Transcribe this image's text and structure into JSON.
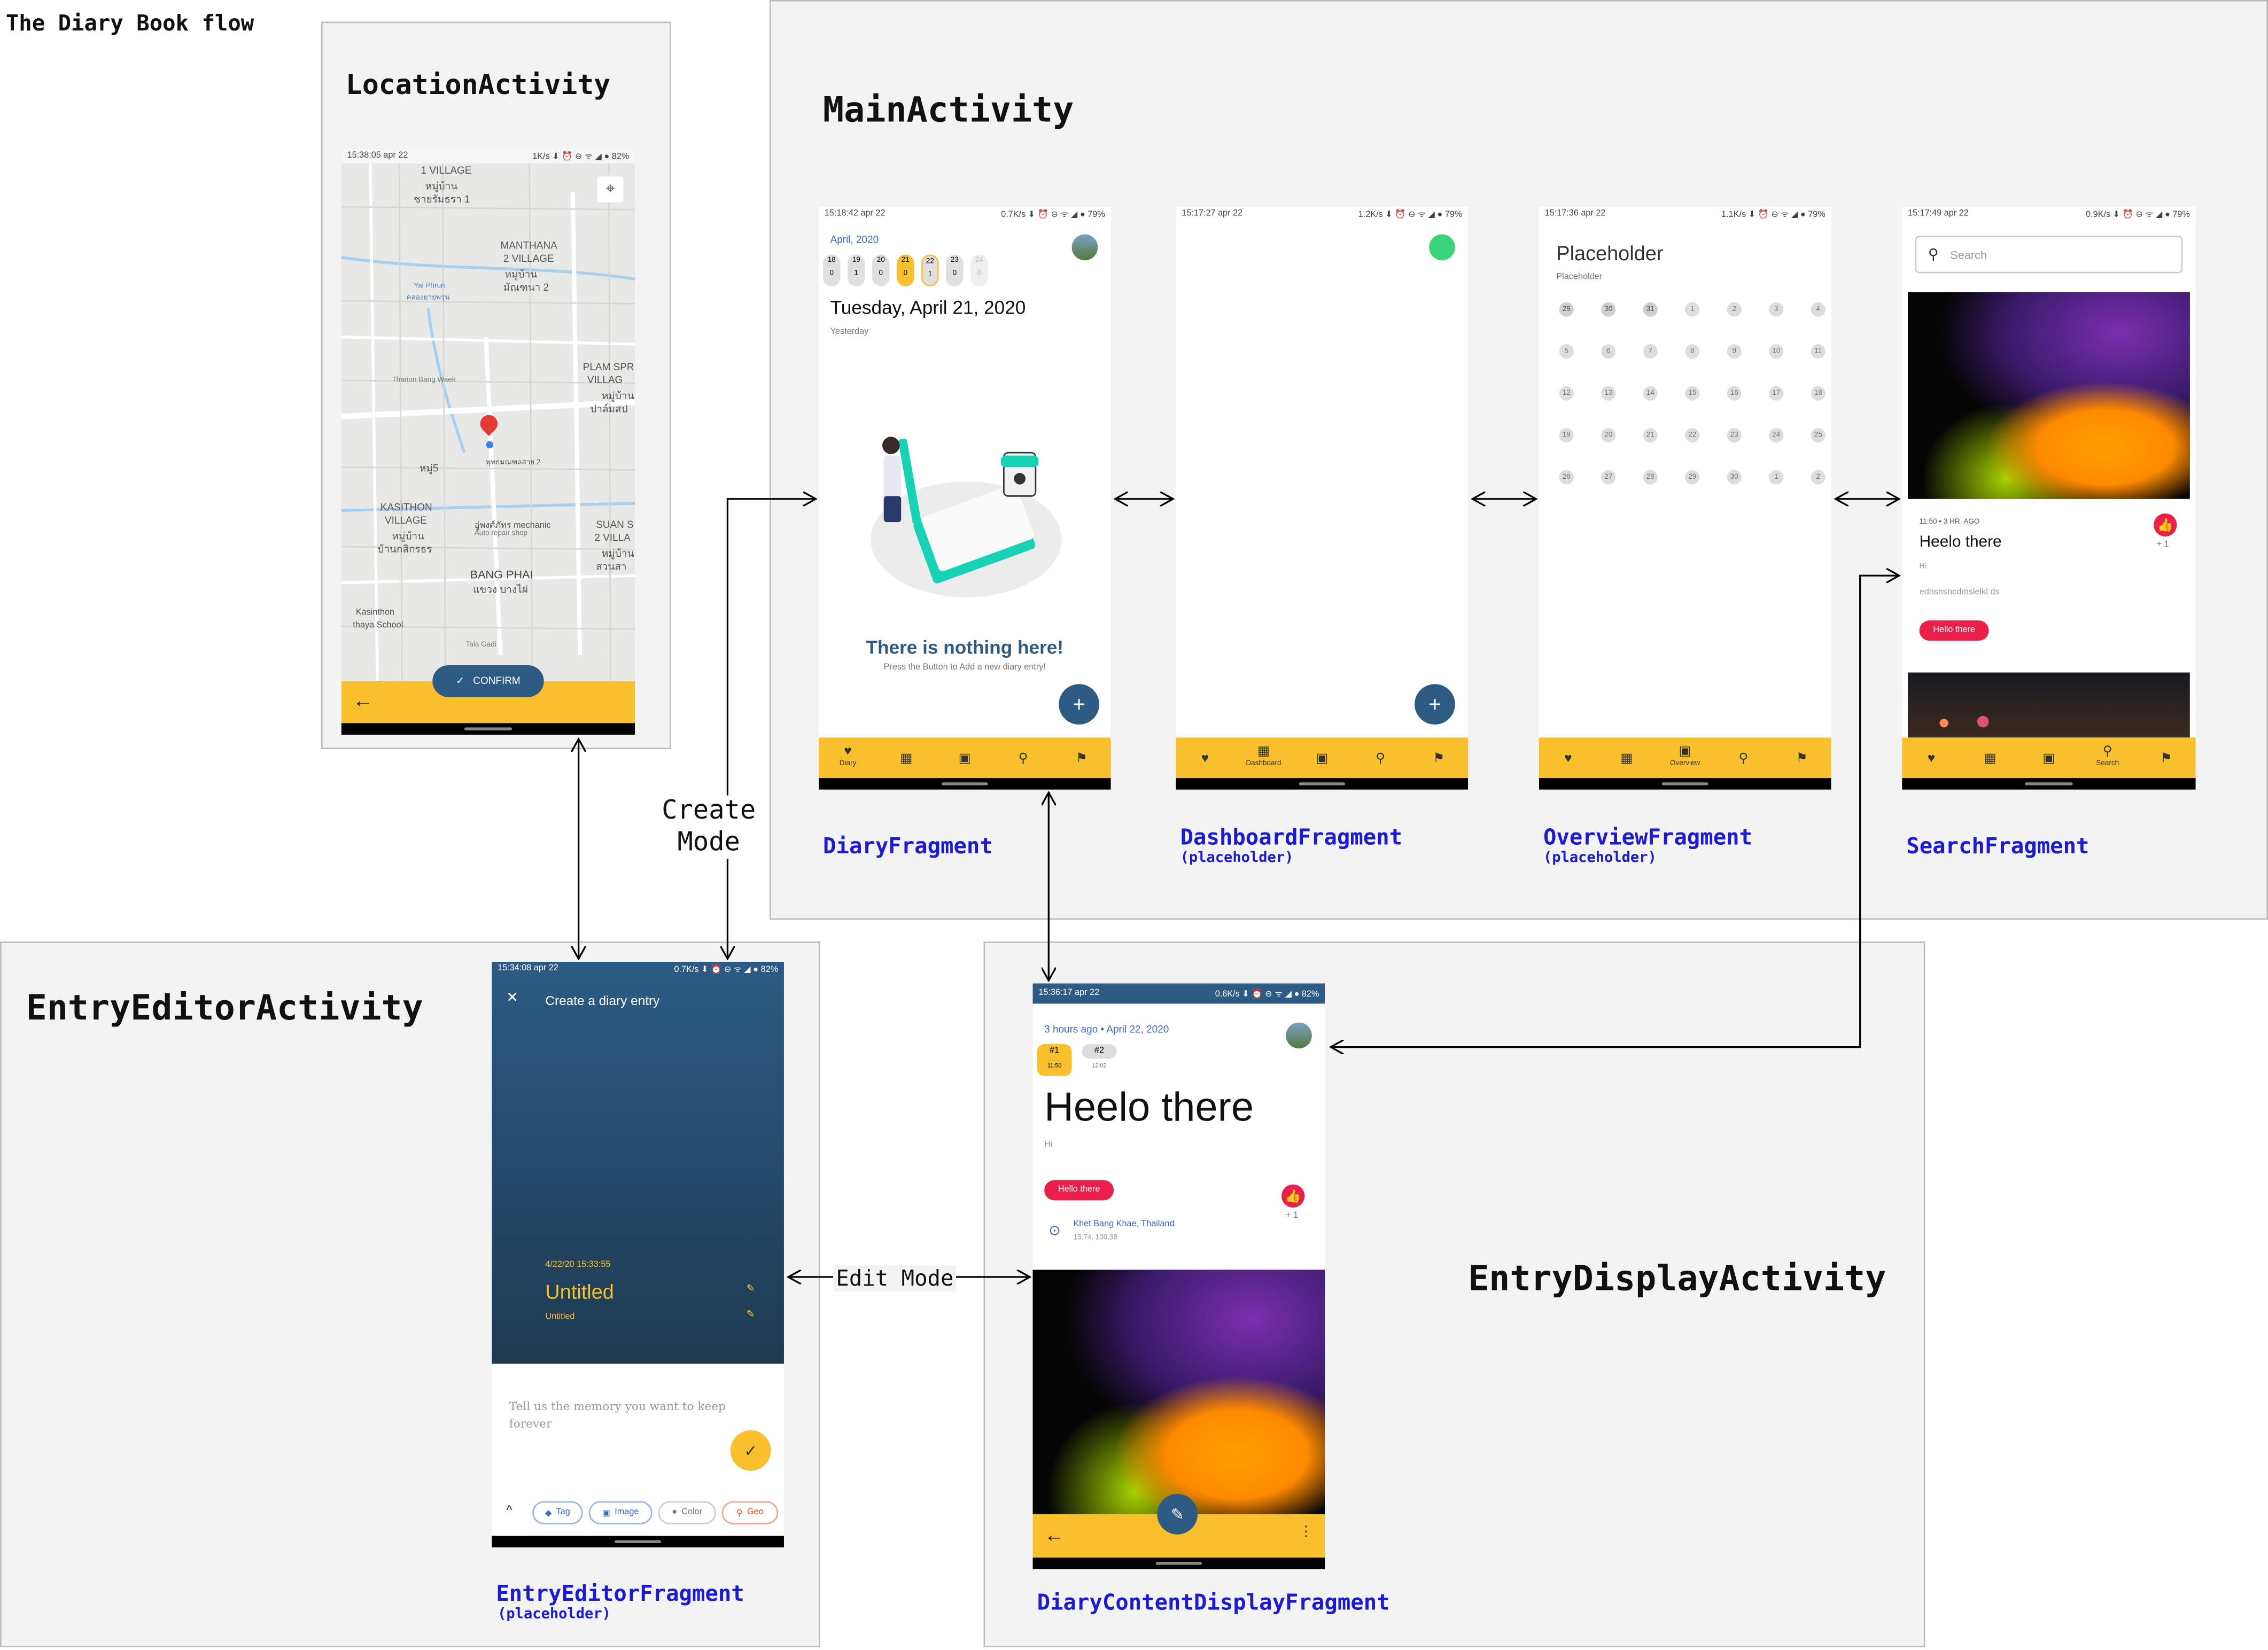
{
  "diagram_title": "The Diary Book flow",
  "sections": {
    "location": "LocationActivity",
    "main": "MainActivity",
    "editor": "EntryEditorActivity",
    "display": "EntryDisplayActivity"
  },
  "fragments": {
    "diary": "DiaryFragment",
    "dashboard": "DashboardFragment",
    "overview": "OverviewFragment",
    "search": "SearchFragment",
    "editor": "EntryEditorFragment",
    "content": "DiaryContentDisplayFragment",
    "placeholder_note": "(placeholder)"
  },
  "flow_labels": {
    "create_line1": "Create",
    "create_line2": "Mode",
    "edit": "Edit Mode"
  },
  "location_screen": {
    "status_time": "15:38:05 apr 22",
    "status_right": "1K/s ⬇ ⏰ ⊖ ᯤ ◢ ● 82%",
    "map_labels": [
      "1 VILLAGE",
      "หมู่บ้าน",
      "ชายรัมธรา 1",
      "MANTHANA",
      "2 VILLAGE",
      "หมู่บ้าน",
      "มัณฑนา 2",
      "Yai Phrun",
      "คลองยายพรุน",
      "Thanon Bang Waek",
      "PLAM SPR",
      "VILLAG",
      "หมู่บ้าน",
      "ปาล์มสป",
      "พุทธมณฑลสาย 2",
      "หมู่5",
      "KASITHON",
      "VILLAGE",
      "หมู่บ้าน",
      "บ้านกสิกรธร",
      "อู่พงศ์ภัทร mechanic",
      "Auto repair shop",
      "SUAN S",
      "2 VILLA",
      "หมู่บ้าน",
      "สวนสา",
      "BANG PHAI",
      "แขวง บางไผ่",
      "Kasinthon",
      "thaya School",
      "Tala Gadi"
    ],
    "confirm_label": "CONFIRM",
    "back_icon": "arrow-left"
  },
  "diary_screen": {
    "status_time": "15:18:42 apr 22",
    "status_right": "0.7K/s ⬇ ⏰ ⊖ ᯤ ◢ ● 79%",
    "month": "April, 2020",
    "days": [
      "18",
      "19",
      "20",
      "21",
      "22",
      "23",
      "24"
    ],
    "day_counts": [
      "0",
      "1",
      "0",
      "0",
      "1",
      "0",
      "0"
    ],
    "date_heading": "Tuesday, April 21, 2020",
    "relative": "Yesterday",
    "empty_title": "There is nothing here!",
    "empty_sub": "Press the Button to Add a new diary entry!",
    "fab": "+"
  },
  "dashboard_screen": {
    "status_time": "15:17:27 apr 22",
    "status_right": "1.2K/s ⬇ ⏰ ⊖ ᯤ ◢ ● 79%",
    "fab": "+"
  },
  "overview_screen": {
    "status_time": "15:17:36 apr 22",
    "status_right": "1.1K/s ⬇ ⏰ ⊖ ᯤ ◢ ● 79%",
    "heading": "Placeholder",
    "sub": "Placeholder",
    "calendar_days": [
      "29",
      "30",
      "31",
      "1",
      "2",
      "3",
      "4",
      "5",
      "6",
      "7",
      "8",
      "9",
      "10",
      "11",
      "12",
      "13",
      "14",
      "15",
      "16",
      "17",
      "18",
      "19",
      "20",
      "21",
      "22",
      "23",
      "24",
      "25",
      "26",
      "27",
      "28",
      "29",
      "30",
      "1",
      "2"
    ]
  },
  "search_screen": {
    "status_time": "15:17:49 apr 22",
    "status_right": "0.9K/s ⬇ ⏰ ⊖ ᯤ ◢ ● 79%",
    "search_placeholder": "Search",
    "card_meta": "11:50 • 3 HR. AGO",
    "card_title": "Heelo there",
    "card_body": "Hi",
    "card_text": "ednsnsncdmslelkl ds",
    "tag": "Hello there",
    "likes": "+ 1"
  },
  "navbar": {
    "diary": "Diary",
    "dashboard": "Dashboard",
    "overview": "Overview",
    "search": "Search"
  },
  "editor_screen": {
    "status_time": "15:34:08 apr 22",
    "status_right": "0.7K/s ⬇ ⏰ ⊖ ᯤ ◢ ● 82%",
    "close": "✕",
    "toolbar_title": "Create a diary entry",
    "timestamp": "4/22/20 15:33:55",
    "entry_title": "Untitled",
    "entry_subtitle": "Untitled",
    "body_placeholder": "Tell us the memory you want to keep forever",
    "chips": [
      "Tag",
      "Image",
      "Color",
      "Geo"
    ]
  },
  "display_screen": {
    "status_time": "15:36:17 apr 22",
    "status_right": "0.6K/s ⬇ ⏰ ⊖ ᯤ ◢ ● 82%",
    "meta": "3 hours ago • April 22, 2020",
    "entry_tabs": [
      "#1",
      "#2"
    ],
    "entry_times": [
      "11:50",
      "12:02"
    ],
    "title": "Heelo there",
    "body": "Hi",
    "tag": "Hello there",
    "likes": "+ 1",
    "location_name": "Khet Bang Khae, Thailand",
    "location_coords": "13.74, 100.38"
  }
}
